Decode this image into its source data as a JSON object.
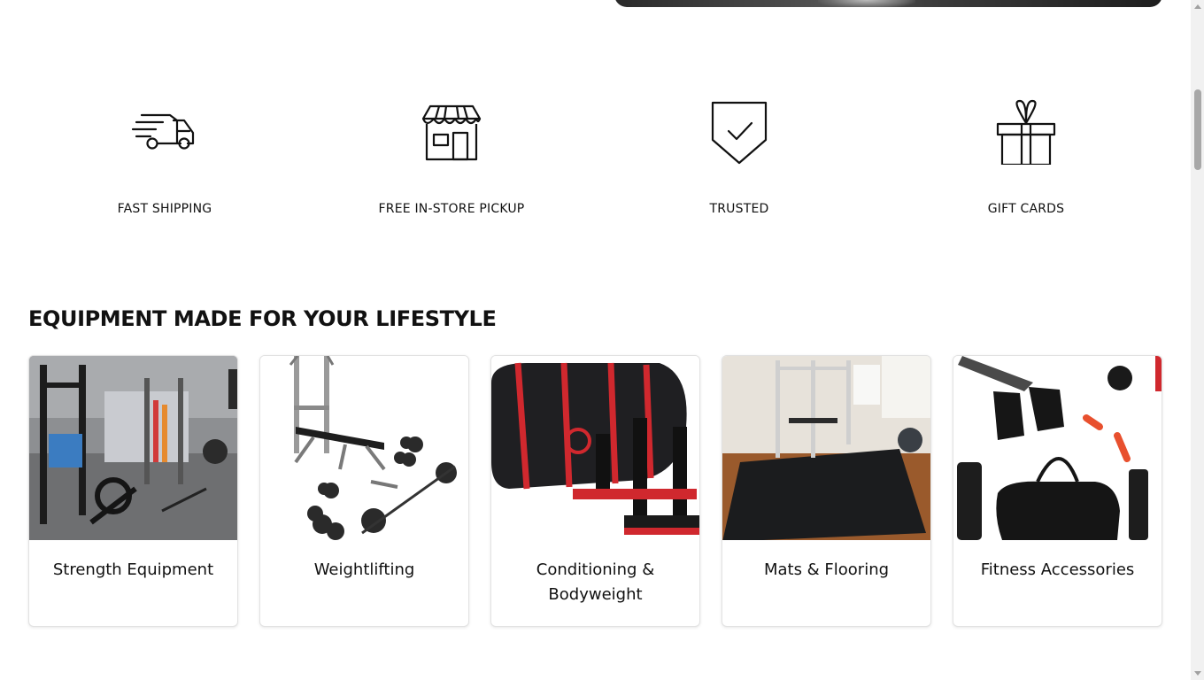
{
  "features": [
    {
      "label": "FAST SHIPPING",
      "icon": "delivery-truck-icon"
    },
    {
      "label": "FREE IN-STORE PICKUP",
      "icon": "storefront-icon"
    },
    {
      "label": "TRUSTED",
      "icon": "shield-check-icon"
    },
    {
      "label": "GIFT CARDS",
      "icon": "gift-box-icon"
    }
  ],
  "section": {
    "title": "EQUIPMENT MADE FOR YOUR LIFESTYLE",
    "categories": [
      {
        "title": "Strength Equipment"
      },
      {
        "title": "Weightlifting"
      },
      {
        "title": "Conditioning & Bodyweight"
      },
      {
        "title": "Mats & Flooring"
      },
      {
        "title": "Fitness Accessories"
      }
    ]
  },
  "colors": {
    "text": "#111111",
    "card_border": "#e2e2e2",
    "accent_red": "#d0282e"
  }
}
